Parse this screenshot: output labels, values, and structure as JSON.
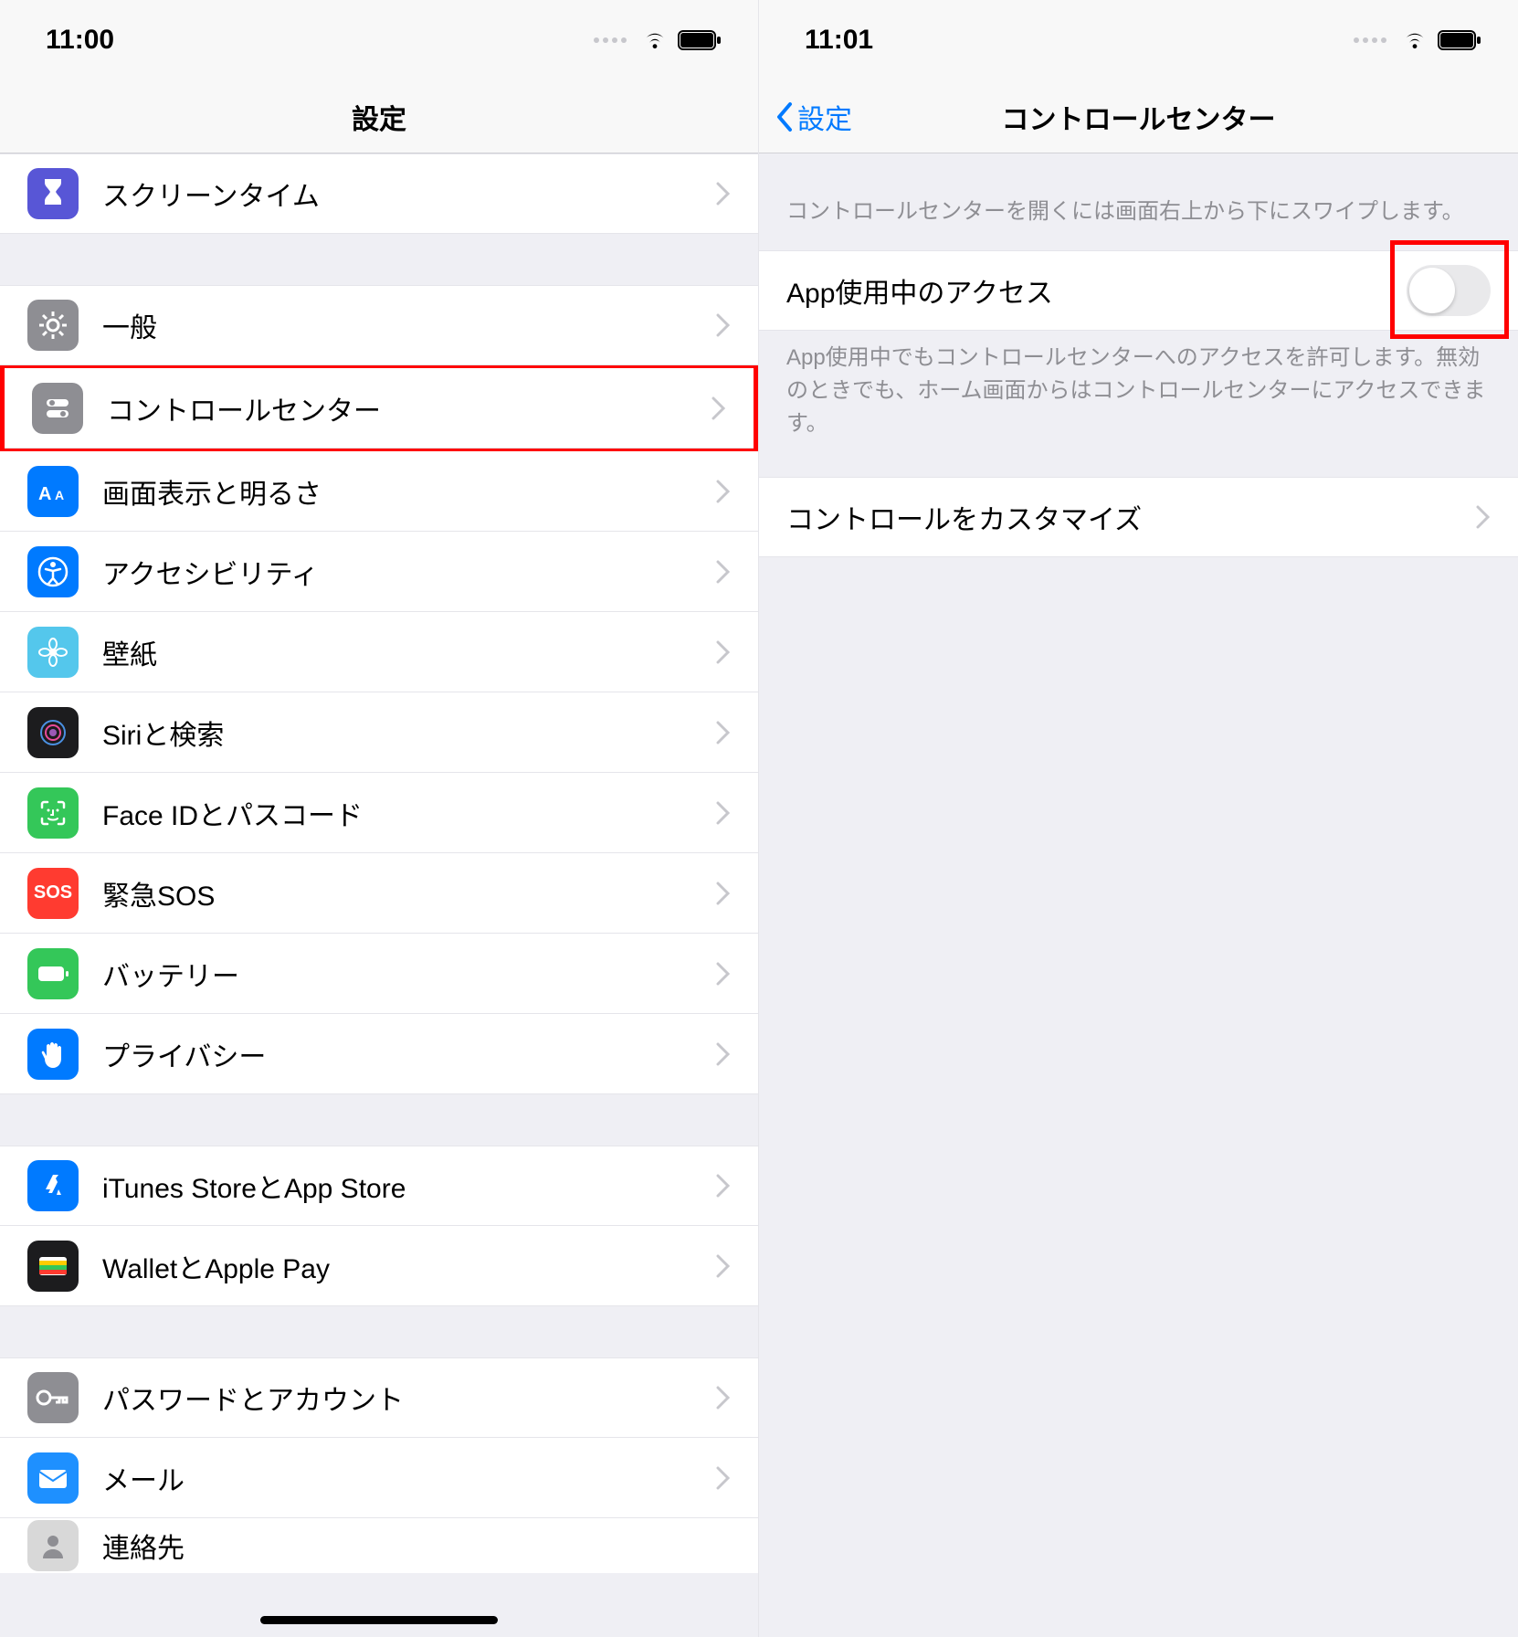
{
  "left": {
    "status_time": "11:00",
    "nav_title": "設定",
    "rows": {
      "screen_time": "スクリーンタイム",
      "general": "一般",
      "control_center": "コントロールセンター",
      "display": "画面表示と明るさ",
      "accessibility": "アクセシビリティ",
      "wallpaper": "壁紙",
      "siri": "Siriと検索",
      "faceid": "Face IDとパスコード",
      "sos": "緊急SOS",
      "battery": "バッテリー",
      "privacy": "プライバシー",
      "itunes": "iTunes StoreとApp Store",
      "wallet": "WalletとApple Pay",
      "passwords": "パスワードとアカウント",
      "mail": "メール",
      "contacts": "連絡先"
    },
    "sos_text": "SOS"
  },
  "right": {
    "status_time": "11:01",
    "back_label": "設定",
    "nav_title": "コントロールセンター",
    "intro_text": "コントロールセンターを開くには画面右上から下にスワイプします。",
    "access_label": "App使用中のアクセス",
    "access_footer": "App使用中でもコントロールセンターへのアクセスを許可します。無効のときでも、ホーム画面からはコントロールセンターにアクセスできます。",
    "customize_label": "コントロールをカスタマイズ"
  }
}
